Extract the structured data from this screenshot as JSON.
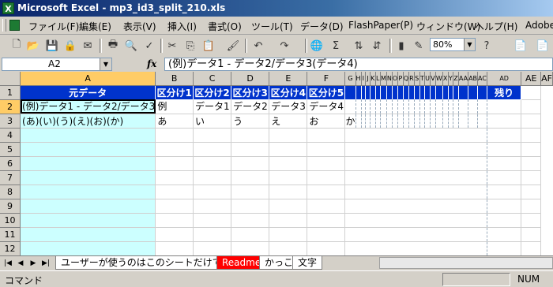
{
  "window": {
    "title": "Microsoft Excel - mp3_id3_split_210.xls"
  },
  "menu": [
    "ファイル(F)",
    "編集(E)",
    "表示(V)",
    "挿入(I)",
    "書式(O)",
    "ツール(T)",
    "データ(D)",
    "FlashPaper(P)",
    "ウィンドウ(W)",
    "ヘルプ(H)",
    "Adobe"
  ],
  "toolbar": {
    "zoom": "80%"
  },
  "formula_bar": {
    "name_box": "A2",
    "fx": "fx",
    "content": "(例)データ1 - データ2/データ3(データ4)"
  },
  "grid": {
    "columns": [
      "A",
      "B",
      "C",
      "D",
      "E",
      "F",
      "G",
      "H",
      "I",
      "J",
      "K",
      "L",
      "M",
      "N",
      "O",
      "P",
      "Q",
      "R",
      "S",
      "T",
      "U",
      "V",
      "W",
      "X",
      "Y",
      "Z",
      "AA",
      "AB",
      "AC",
      "AD",
      "AE",
      "AF"
    ],
    "header_row": {
      "a": "元データ",
      "b": "区分け1",
      "c": "区分け2",
      "d": "区分け3",
      "e": "区分け4",
      "f": "区分け5",
      "ae": "残り"
    },
    "row2": {
      "a": "(例)データ1 - データ2/データ3",
      "b": "例",
      "c": "データ1",
      "d": "データ2",
      "e": "データ3",
      "f": "データ4"
    },
    "row3": {
      "a": "(あ)(い)(う)(え)(お)(か)",
      "b": "あ",
      "c": "い",
      "d": "う",
      "e": "え",
      "f": "お",
      "g": "か"
    },
    "row_numbers": [
      "1",
      "2",
      "3",
      "4",
      "5",
      "6",
      "7",
      "8",
      "9",
      "10",
      "11",
      "12"
    ]
  },
  "sheet_tabs": [
    "ユーザーが使うのはこのシートだけです",
    "Readme",
    "かっこ",
    "文字"
  ],
  "status": {
    "left": "コマンド",
    "right": "NUM"
  },
  "colors": {
    "header_blue": "#0033cc",
    "col_a_fill": "#ccffff",
    "tab_red": "#ff0000"
  }
}
